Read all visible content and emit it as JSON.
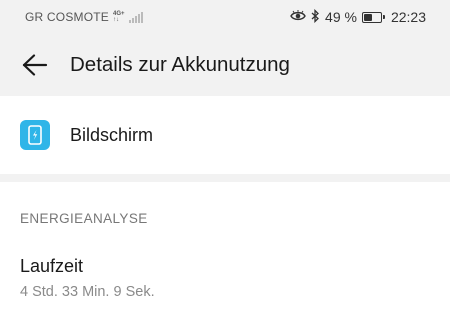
{
  "status_bar": {
    "carrier": "GR COSMOTE",
    "network_type_top": "4G+",
    "network_type_bottom": "↑↓",
    "battery_percent": "49 %",
    "battery_level": 0.49,
    "time": "22:23",
    "icons": [
      "eye-icon",
      "bluetooth-icon",
      "battery-icon",
      "signal-icon"
    ]
  },
  "app_bar": {
    "title": "Details zur Akkunutzung",
    "back_icon": "arrow-left-icon"
  },
  "app_item": {
    "label": "Bildschirm",
    "icon": "screen-brightness-icon",
    "icon_color": "#2fb5e8"
  },
  "energy_section": {
    "header": "ENERGIEANALYSE",
    "runtime_label": "Laufzeit",
    "runtime_value": "4 Std. 33 Min. 9 Sek."
  }
}
